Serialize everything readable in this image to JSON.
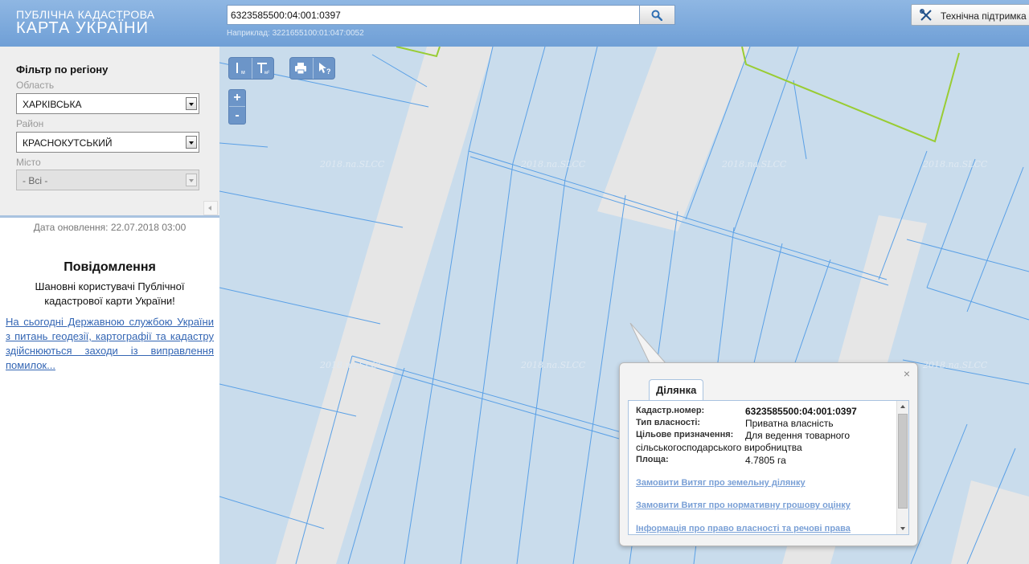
{
  "header": {
    "logo_line1": "ПУБЛІЧНА КАДАСТРОВА",
    "logo_line2": "КАРТА УКРАЇНИ",
    "search_value": "6323585500:04:001:0397",
    "search_hint": "Наприклад: 3221655100:01:047:0052",
    "support_label": "Технічна підтримка"
  },
  "filter": {
    "title": "Фільтр по регіону",
    "oblast_label": "Область",
    "oblast_value": "ХАРКІВСЬКА",
    "raion_label": "Район",
    "raion_value": "КРАСНОКУТСЬКИЙ",
    "misto_label": "Місто",
    "misto_value": "- Всі -"
  },
  "update_date": "Дата оновлення: 22.07.2018 03:00",
  "news": {
    "title": "Повідомлення",
    "text": "Шановні користувачі Публічної кадастрової карти України!",
    "link": "На сьогодні Державною службою України з питань геодезії, картографії та кадастру здійснюються заходи із виправлення помилок..."
  },
  "map": {
    "watermark": "2018.na.SLCC",
    "zoom_in": "+",
    "zoom_out": "-",
    "parcel_fill": "#c9dcec",
    "parcel_stroke": "#5aa0e6",
    "road_fill": "#e6e6e6",
    "highlight_stroke": "#99cc33"
  },
  "popup": {
    "close": "×",
    "tab": "Ділянка",
    "cadastral_label": "Кадастр.номер:",
    "cadastral_value": "6323585500:04:001:0397",
    "ownership_label": "Тип власності:",
    "ownership_value": "Приватна власність",
    "purpose_label": "Цільове призначення:",
    "purpose_value": "Для ведення товарного",
    "purpose_value_cont": "сільськогосподарського виробництва",
    "area_label": "Площа:",
    "area_value": "4.7805 га",
    "link1": "Замовити Витяг про земельну ділянку",
    "link2": "Замовити Витяг про нормативну грошову оцінку",
    "link3": "Інформація про право власності та речові права"
  }
}
